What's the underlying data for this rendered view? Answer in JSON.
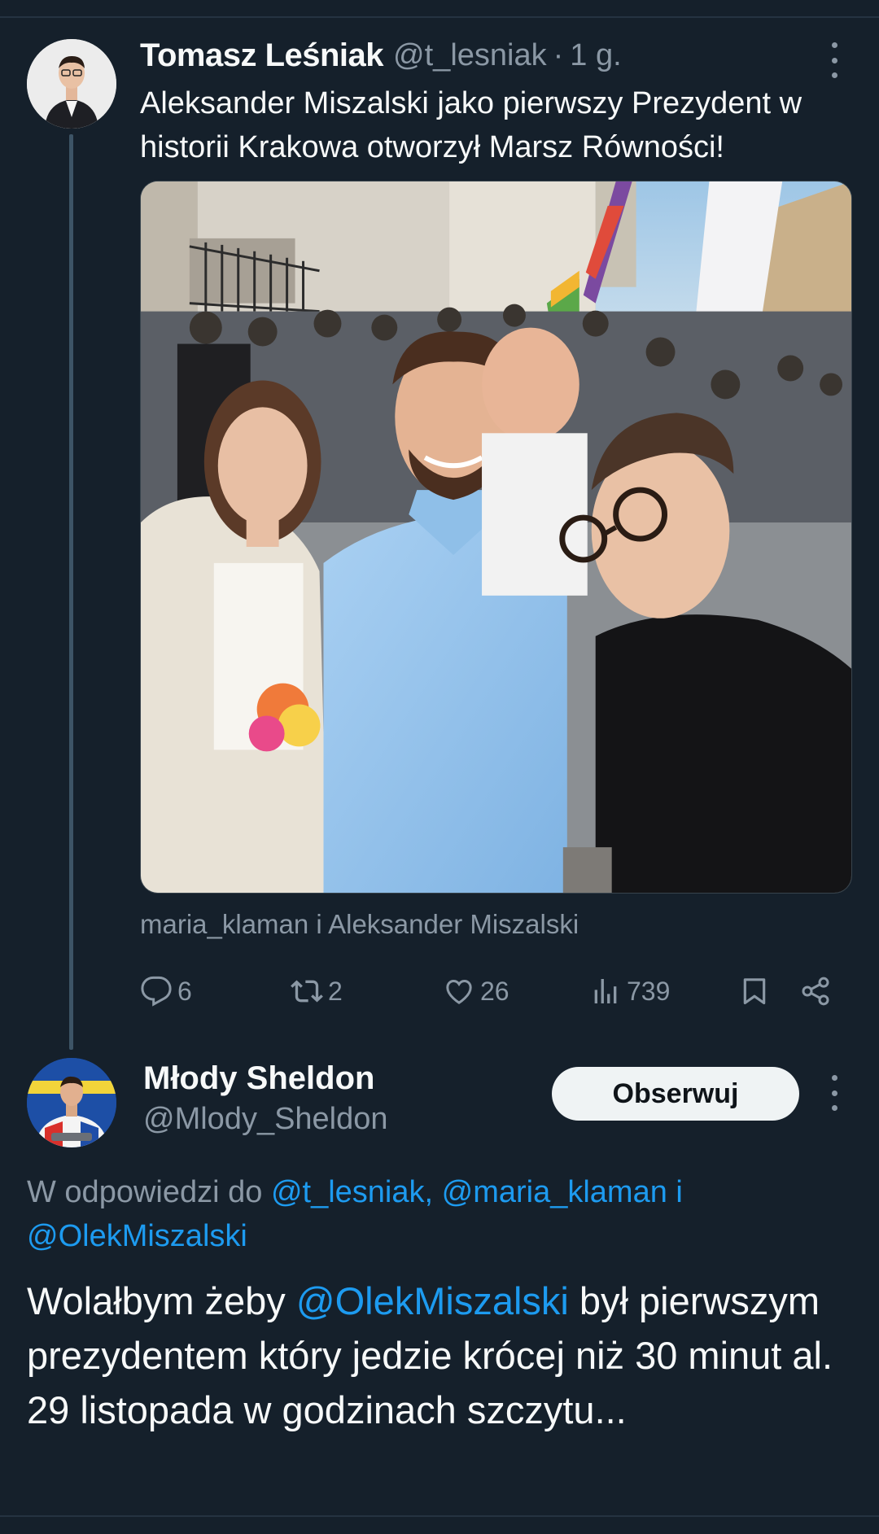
{
  "tweet1": {
    "author_name": "Tomasz Leśniak",
    "author_handle": "@t_lesniak",
    "separator": "·",
    "time": "1 g.",
    "text": "Aleksander Miszalski jako pierwszy Prezydent w historii Krakowa otworzył Marsz Równości!",
    "photo_tags": "maria_klaman i Aleksander Miszalski",
    "stats": {
      "replies": "6",
      "retweets": "2",
      "likes": "26",
      "views": "739"
    }
  },
  "tweet2": {
    "author_name": "Młody Sheldon",
    "author_handle": "@Mlody_Sheldon",
    "follow_label": "Obserwuj",
    "replying_prefix": "W odpowiedzi do",
    "replying_mentions": "@t_lesniak, @maria_klaman",
    "replying_joiner": "i",
    "replying_last": "@OlekMiszalski",
    "text_before": "Wolałbym żeby",
    "text_mention": "@OlekMiszalski",
    "text_after": "był pierwszym prezydentem który jedzie krócej niż 30 minut al. 29 listopada w godzinach szczytu..."
  },
  "icons": {
    "reply": "reply-icon",
    "retweet": "retweet-icon",
    "like": "heart-icon",
    "views": "views-icon",
    "bookmark": "bookmark-icon",
    "share": "share-icon",
    "more": "more-icon",
    "person": "person-icon"
  },
  "colors": {
    "background": "#15202b",
    "text": "#f7f9f9",
    "secondary": "#8b98a5",
    "link": "#1d9bf0",
    "follow_button": "#eff3f4"
  }
}
